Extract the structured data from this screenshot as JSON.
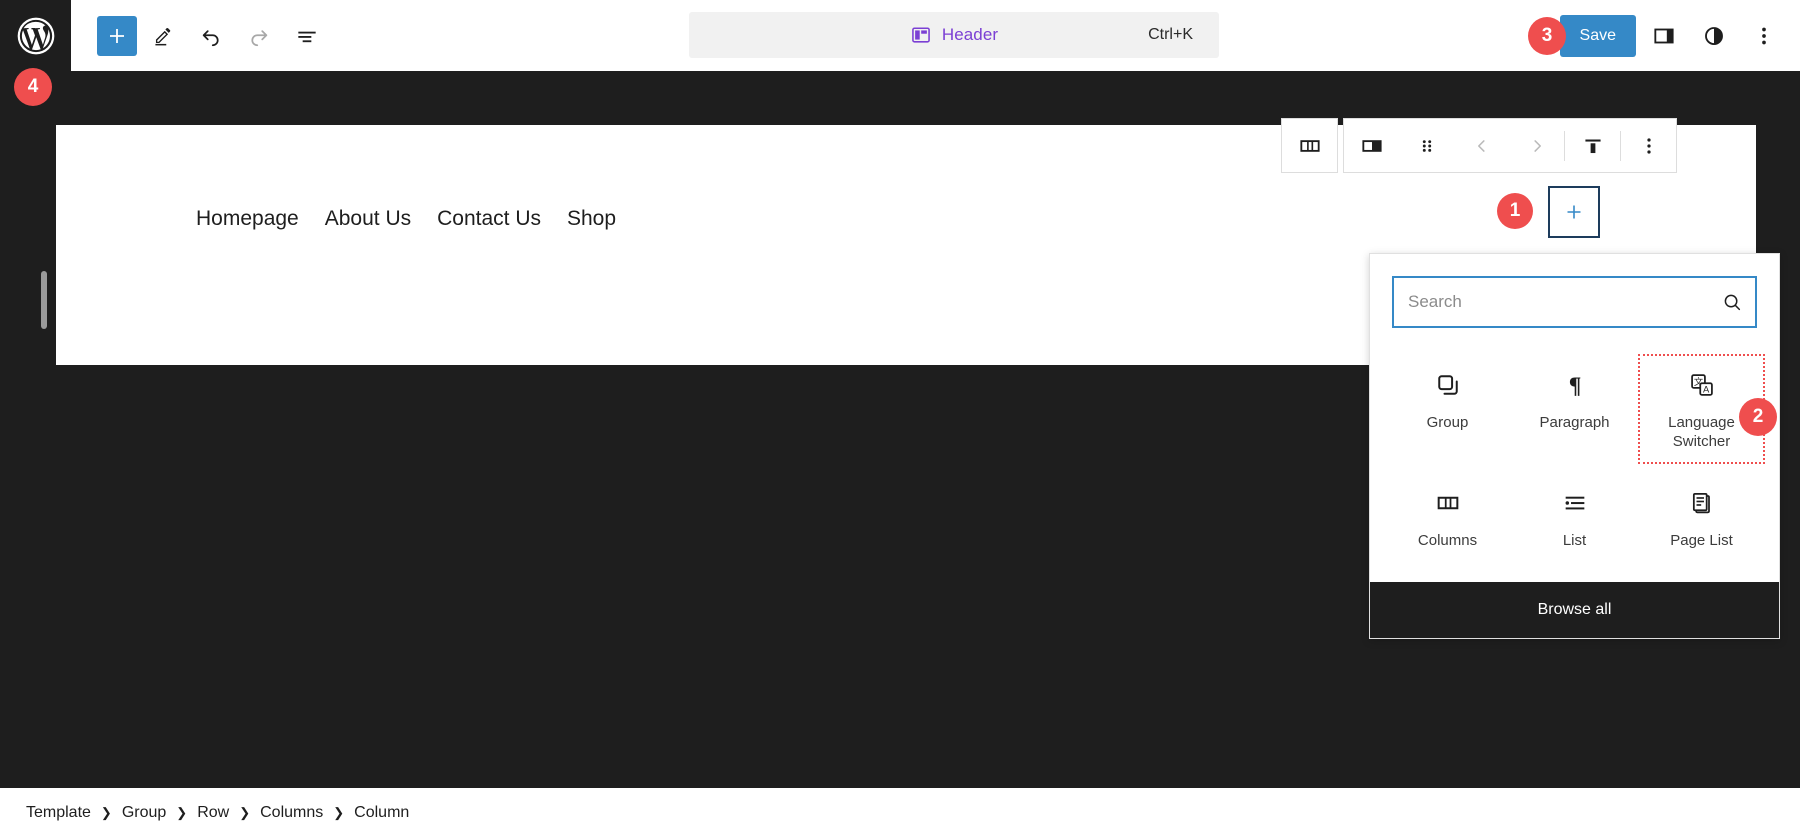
{
  "app": {
    "logo_icon": "wordpress-logo-icon",
    "background_dark": "#1e1e1e",
    "accent_blue": "#3589c7",
    "badge_red": "#ef4e4e",
    "template_purple": "#7b3fd4"
  },
  "toolbar": {
    "add_block_label": "+",
    "tools": [
      {
        "name": "block-inserter-toggle",
        "icon": "plus-icon"
      },
      {
        "name": "edit-tool",
        "icon": "pencil-icon"
      },
      {
        "name": "undo",
        "icon": "undo-arrow-icon"
      },
      {
        "name": "redo",
        "icon": "redo-arrow-icon"
      },
      {
        "name": "document-overview",
        "icon": "list-view-icon"
      }
    ]
  },
  "document_bar": {
    "icon": "template-part-icon",
    "title": "Header",
    "shortcut": "Ctrl+K"
  },
  "topbar_right": {
    "save_label": "Save",
    "settings_icon": "sidebar-panel-icon",
    "styles_icon": "contrast-circle-icon",
    "options_icon": "more-vertical-icon"
  },
  "badges": [
    {
      "id": "1",
      "label": "1"
    },
    {
      "id": "2",
      "label": "2"
    },
    {
      "id": "3",
      "label": "3"
    },
    {
      "id": "4",
      "label": "4"
    }
  ],
  "canvas": {
    "nav_items": [
      {
        "label": "Homepage"
      },
      {
        "label": "About Us"
      },
      {
        "label": "Contact Us"
      },
      {
        "label": "Shop"
      }
    ],
    "appender_label": "+"
  },
  "block_toolbar": {
    "buttons": [
      {
        "name": "parent-columns-block",
        "icon": "columns-icon",
        "dim": false
      },
      {
        "name": "change-block-type",
        "icon": "column-icon",
        "dim": false
      },
      {
        "name": "drag-handle",
        "icon": "drag-dots-icon",
        "dim": false
      },
      {
        "name": "move-left",
        "icon": "chevron-left-icon",
        "dim": true
      },
      {
        "name": "move-right",
        "icon": "chevron-right-icon",
        "dim": true
      },
      {
        "name": "vertical-align-top",
        "icon": "align-top-icon",
        "dim": false
      },
      {
        "name": "block-options",
        "icon": "more-vertical-icon",
        "dim": false
      }
    ]
  },
  "inserter": {
    "search": {
      "value": "",
      "placeholder": "Search",
      "icon": "search-icon"
    },
    "blocks": [
      {
        "name": "group",
        "label": "Group",
        "icon": "group-icon",
        "highlight": false
      },
      {
        "name": "paragraph",
        "label": "Paragraph",
        "icon": "paragraph-pilcrow-icon",
        "highlight": false
      },
      {
        "name": "language-switcher",
        "label": "Language Switcher",
        "icon": "language-switcher-icon",
        "highlight": true
      },
      {
        "name": "columns",
        "label": "Columns",
        "icon": "columns-icon",
        "highlight": false
      },
      {
        "name": "list",
        "label": "List",
        "icon": "list-icon",
        "highlight": false
      },
      {
        "name": "page-list",
        "label": "Page List",
        "icon": "page-list-icon",
        "highlight": false
      }
    ],
    "browse_all_label": "Browse all"
  },
  "breadcrumb": {
    "separator": "❯",
    "items": [
      {
        "label": "Template"
      },
      {
        "label": "Group"
      },
      {
        "label": "Row"
      },
      {
        "label": "Columns"
      },
      {
        "label": "Column"
      }
    ]
  }
}
